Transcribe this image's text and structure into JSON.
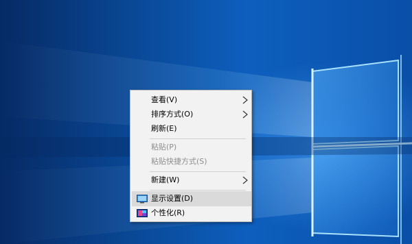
{
  "desktop": {
    "wallpaper": "windows-10-hero",
    "colors": {
      "deep": "#062a64",
      "mid": "#0d5fbe",
      "glow": "#7fd0ff"
    }
  },
  "context_menu": {
    "items": [
      {
        "label": "查看(V)",
        "submenu": true,
        "enabled": true
      },
      {
        "label": "排序方式(O)",
        "submenu": true,
        "enabled": true
      },
      {
        "label": "刷新(E)",
        "submenu": false,
        "enabled": true
      },
      {
        "label": "粘贴(P)",
        "submenu": false,
        "enabled": false
      },
      {
        "label": "粘贴快捷方式(S)",
        "submenu": false,
        "enabled": false
      },
      {
        "label": "新建(W)",
        "submenu": true,
        "enabled": true
      },
      {
        "label": "显示设置(D)",
        "icon": "display-settings-icon",
        "enabled": true,
        "highlighted": true
      },
      {
        "label": "个性化(R)",
        "icon": "personalize-icon",
        "enabled": true
      }
    ]
  }
}
